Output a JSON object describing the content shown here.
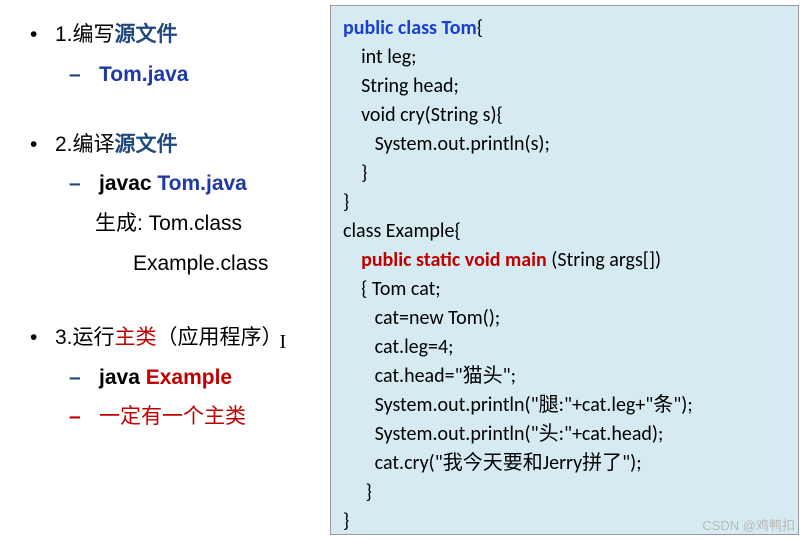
{
  "left": {
    "step1": {
      "num": "1.",
      "text_a": "编写",
      "text_b": "源文件",
      "sub": "Tom.java"
    },
    "step2": {
      "num": "2.",
      "text_a": "编译",
      "text_b": "源文件",
      "sub_a": "javac ",
      "sub_b": "Tom.java",
      "gen_label": "生成: ",
      "gen1": "Tom.class",
      "gen2": "Example.class"
    },
    "step3": {
      "num": "3.",
      "text_a": "运行",
      "text_b": "主类",
      "text_c": "（应用程序）",
      "sub_a": "java ",
      "sub_b": "Example",
      "note": "一定有一个主类"
    }
  },
  "code": {
    "l1_a": "public class Tom",
    "l1_b": "{",
    "l2": "    int leg;",
    "l3": "    String head;",
    "l4": "    void cry(String s){",
    "l5": "       System.out.println(s);",
    "l6": "    }",
    "l7": "}",
    "l8": "class Example{",
    "l9_a": "    ",
    "l9_b": "public static void main",
    "l9_c": " (String args[])",
    "l10": "    { Tom cat;",
    "l11": "       cat=new Tom();",
    "l12": "       cat.leg=4;",
    "l13": "       cat.head=\"猫头\";",
    "l14": "       System.out.println(\"腿:\"+cat.leg+\"条\");",
    "l15": "       System.out.println(\"头:\"+cat.head);",
    "l16": "       cat.cry(\"我今天要和Jerry拼了\");",
    "l17": "     }",
    "l18": "}"
  },
  "watermark": "CSDN @鸡鸭扣"
}
